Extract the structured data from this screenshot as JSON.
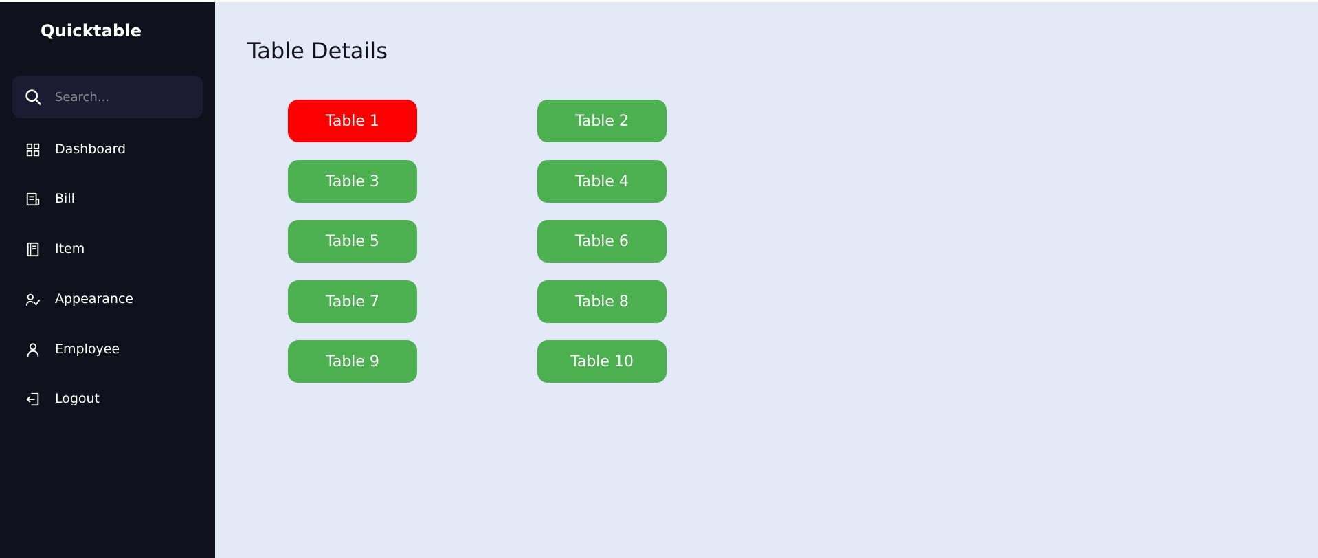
{
  "app": {
    "brand": "Quicktable"
  },
  "sidebar": {
    "search": {
      "placeholder": "Search...",
      "value": ""
    },
    "items": [
      {
        "label": "Dashboard",
        "icon": "grid-icon"
      },
      {
        "label": "Bill",
        "icon": "receipt-icon"
      },
      {
        "label": "Item",
        "icon": "notebook-icon"
      },
      {
        "label": "Appearance",
        "icon": "user-check-icon"
      },
      {
        "label": "Employee",
        "icon": "user-icon"
      },
      {
        "label": "Logout",
        "icon": "logout-icon"
      }
    ]
  },
  "main": {
    "title": "Table Details",
    "tables": [
      {
        "label": "Table 1",
        "status": "occupied"
      },
      {
        "label": "Table 2",
        "status": "available"
      },
      {
        "label": "Table 3",
        "status": "available"
      },
      {
        "label": "Table 4",
        "status": "available"
      },
      {
        "label": "Table 5",
        "status": "available"
      },
      {
        "label": "Table 6",
        "status": "available"
      },
      {
        "label": "Table 7",
        "status": "available"
      },
      {
        "label": "Table 8",
        "status": "available"
      },
      {
        "label": "Table 9",
        "status": "available"
      },
      {
        "label": "Table 10",
        "status": "available"
      }
    ]
  },
  "colors": {
    "sidebar_bg": "#11101d",
    "search_bg": "#1d1b31",
    "page_bg": "#e4e9f7",
    "available": "#4caf50",
    "occupied": "#ff0000"
  }
}
